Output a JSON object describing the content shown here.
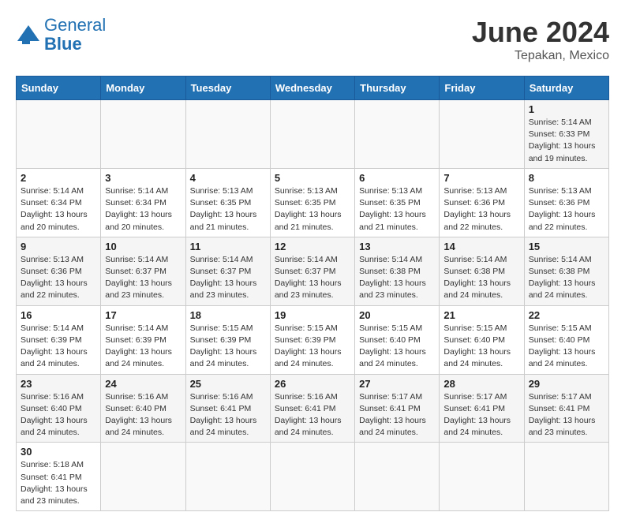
{
  "logo": {
    "general": "General",
    "blue": "Blue"
  },
  "header": {
    "month_year": "June 2024",
    "location": "Tepakan, Mexico"
  },
  "weekdays": [
    "Sunday",
    "Monday",
    "Tuesday",
    "Wednesday",
    "Thursday",
    "Friday",
    "Saturday"
  ],
  "weeks": [
    [
      {
        "day": "",
        "info": ""
      },
      {
        "day": "",
        "info": ""
      },
      {
        "day": "",
        "info": ""
      },
      {
        "day": "",
        "info": ""
      },
      {
        "day": "",
        "info": ""
      },
      {
        "day": "",
        "info": ""
      },
      {
        "day": "1",
        "info": "Sunrise: 5:14 AM\nSunset: 6:33 PM\nDaylight: 13 hours\nand 19 minutes."
      }
    ],
    [
      {
        "day": "2",
        "info": "Sunrise: 5:14 AM\nSunset: 6:34 PM\nDaylight: 13 hours\nand 20 minutes."
      },
      {
        "day": "3",
        "info": "Sunrise: 5:14 AM\nSunset: 6:34 PM\nDaylight: 13 hours\nand 20 minutes."
      },
      {
        "day": "4",
        "info": "Sunrise: 5:13 AM\nSunset: 6:35 PM\nDaylight: 13 hours\nand 21 minutes."
      },
      {
        "day": "5",
        "info": "Sunrise: 5:13 AM\nSunset: 6:35 PM\nDaylight: 13 hours\nand 21 minutes."
      },
      {
        "day": "6",
        "info": "Sunrise: 5:13 AM\nSunset: 6:35 PM\nDaylight: 13 hours\nand 21 minutes."
      },
      {
        "day": "7",
        "info": "Sunrise: 5:13 AM\nSunset: 6:36 PM\nDaylight: 13 hours\nand 22 minutes."
      },
      {
        "day": "8",
        "info": "Sunrise: 5:13 AM\nSunset: 6:36 PM\nDaylight: 13 hours\nand 22 minutes."
      }
    ],
    [
      {
        "day": "9",
        "info": "Sunrise: 5:13 AM\nSunset: 6:36 PM\nDaylight: 13 hours\nand 22 minutes."
      },
      {
        "day": "10",
        "info": "Sunrise: 5:14 AM\nSunset: 6:37 PM\nDaylight: 13 hours\nand 23 minutes."
      },
      {
        "day": "11",
        "info": "Sunrise: 5:14 AM\nSunset: 6:37 PM\nDaylight: 13 hours\nand 23 minutes."
      },
      {
        "day": "12",
        "info": "Sunrise: 5:14 AM\nSunset: 6:37 PM\nDaylight: 13 hours\nand 23 minutes."
      },
      {
        "day": "13",
        "info": "Sunrise: 5:14 AM\nSunset: 6:38 PM\nDaylight: 13 hours\nand 23 minutes."
      },
      {
        "day": "14",
        "info": "Sunrise: 5:14 AM\nSunset: 6:38 PM\nDaylight: 13 hours\nand 24 minutes."
      },
      {
        "day": "15",
        "info": "Sunrise: 5:14 AM\nSunset: 6:38 PM\nDaylight: 13 hours\nand 24 minutes."
      }
    ],
    [
      {
        "day": "16",
        "info": "Sunrise: 5:14 AM\nSunset: 6:39 PM\nDaylight: 13 hours\nand 24 minutes."
      },
      {
        "day": "17",
        "info": "Sunrise: 5:14 AM\nSunset: 6:39 PM\nDaylight: 13 hours\nand 24 minutes."
      },
      {
        "day": "18",
        "info": "Sunrise: 5:15 AM\nSunset: 6:39 PM\nDaylight: 13 hours\nand 24 minutes."
      },
      {
        "day": "19",
        "info": "Sunrise: 5:15 AM\nSunset: 6:39 PM\nDaylight: 13 hours\nand 24 minutes."
      },
      {
        "day": "20",
        "info": "Sunrise: 5:15 AM\nSunset: 6:40 PM\nDaylight: 13 hours\nand 24 minutes."
      },
      {
        "day": "21",
        "info": "Sunrise: 5:15 AM\nSunset: 6:40 PM\nDaylight: 13 hours\nand 24 minutes."
      },
      {
        "day": "22",
        "info": "Sunrise: 5:15 AM\nSunset: 6:40 PM\nDaylight: 13 hours\nand 24 minutes."
      }
    ],
    [
      {
        "day": "23",
        "info": "Sunrise: 5:16 AM\nSunset: 6:40 PM\nDaylight: 13 hours\nand 24 minutes."
      },
      {
        "day": "24",
        "info": "Sunrise: 5:16 AM\nSunset: 6:40 PM\nDaylight: 13 hours\nand 24 minutes."
      },
      {
        "day": "25",
        "info": "Sunrise: 5:16 AM\nSunset: 6:41 PM\nDaylight: 13 hours\nand 24 minutes."
      },
      {
        "day": "26",
        "info": "Sunrise: 5:16 AM\nSunset: 6:41 PM\nDaylight: 13 hours\nand 24 minutes."
      },
      {
        "day": "27",
        "info": "Sunrise: 5:17 AM\nSunset: 6:41 PM\nDaylight: 13 hours\nand 24 minutes."
      },
      {
        "day": "28",
        "info": "Sunrise: 5:17 AM\nSunset: 6:41 PM\nDaylight: 13 hours\nand 24 minutes."
      },
      {
        "day": "29",
        "info": "Sunrise: 5:17 AM\nSunset: 6:41 PM\nDaylight: 13 hours\nand 23 minutes."
      }
    ],
    [
      {
        "day": "30",
        "info": "Sunrise: 5:18 AM\nSunset: 6:41 PM\nDaylight: 13 hours\nand 23 minutes."
      },
      {
        "day": "",
        "info": ""
      },
      {
        "day": "",
        "info": ""
      },
      {
        "day": "",
        "info": ""
      },
      {
        "day": "",
        "info": ""
      },
      {
        "day": "",
        "info": ""
      },
      {
        "day": "",
        "info": ""
      }
    ]
  ]
}
